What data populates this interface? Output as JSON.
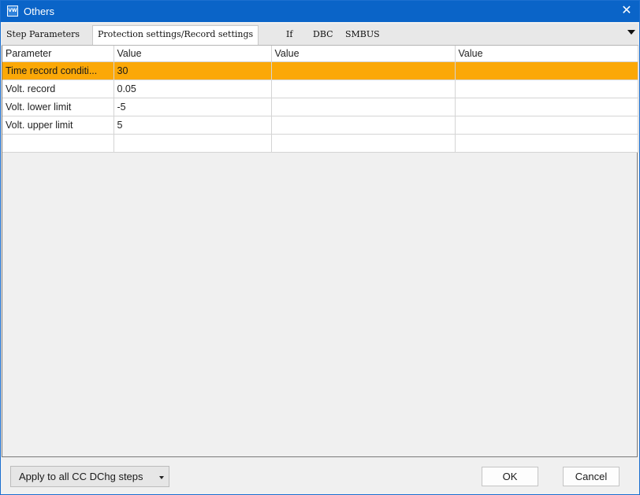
{
  "window": {
    "title": "Others",
    "icon": "app-icon",
    "close_icon": "close-icon"
  },
  "tabs": [
    {
      "label": "Step Parameters",
      "active": false
    },
    {
      "label": "Protection settings/Record settings",
      "active": true
    },
    {
      "label": "If",
      "active": false
    },
    {
      "label": "DBC",
      "active": false
    },
    {
      "label": "SMBUS",
      "active": false
    }
  ],
  "grid": {
    "columns": [
      "Parameter",
      "Value",
      "Value",
      "Value"
    ],
    "rows": [
      {
        "cells": [
          "Time record conditi...",
          "30",
          "",
          ""
        ],
        "selected": true
      },
      {
        "cells": [
          "Volt. record",
          "0.05",
          "",
          ""
        ],
        "selected": false
      },
      {
        "cells": [
          "Volt. lower limit",
          "-5",
          "",
          ""
        ],
        "selected": false
      },
      {
        "cells": [
          "Volt. upper limit",
          "5",
          "",
          ""
        ],
        "selected": false
      },
      {
        "cells": [
          "",
          "",
          "",
          ""
        ],
        "selected": false
      }
    ],
    "selected_color": "#fba807"
  },
  "footer": {
    "apply_label": "Apply to all CC DChg steps",
    "ok_label": "OK",
    "cancel_label": "Cancel"
  }
}
